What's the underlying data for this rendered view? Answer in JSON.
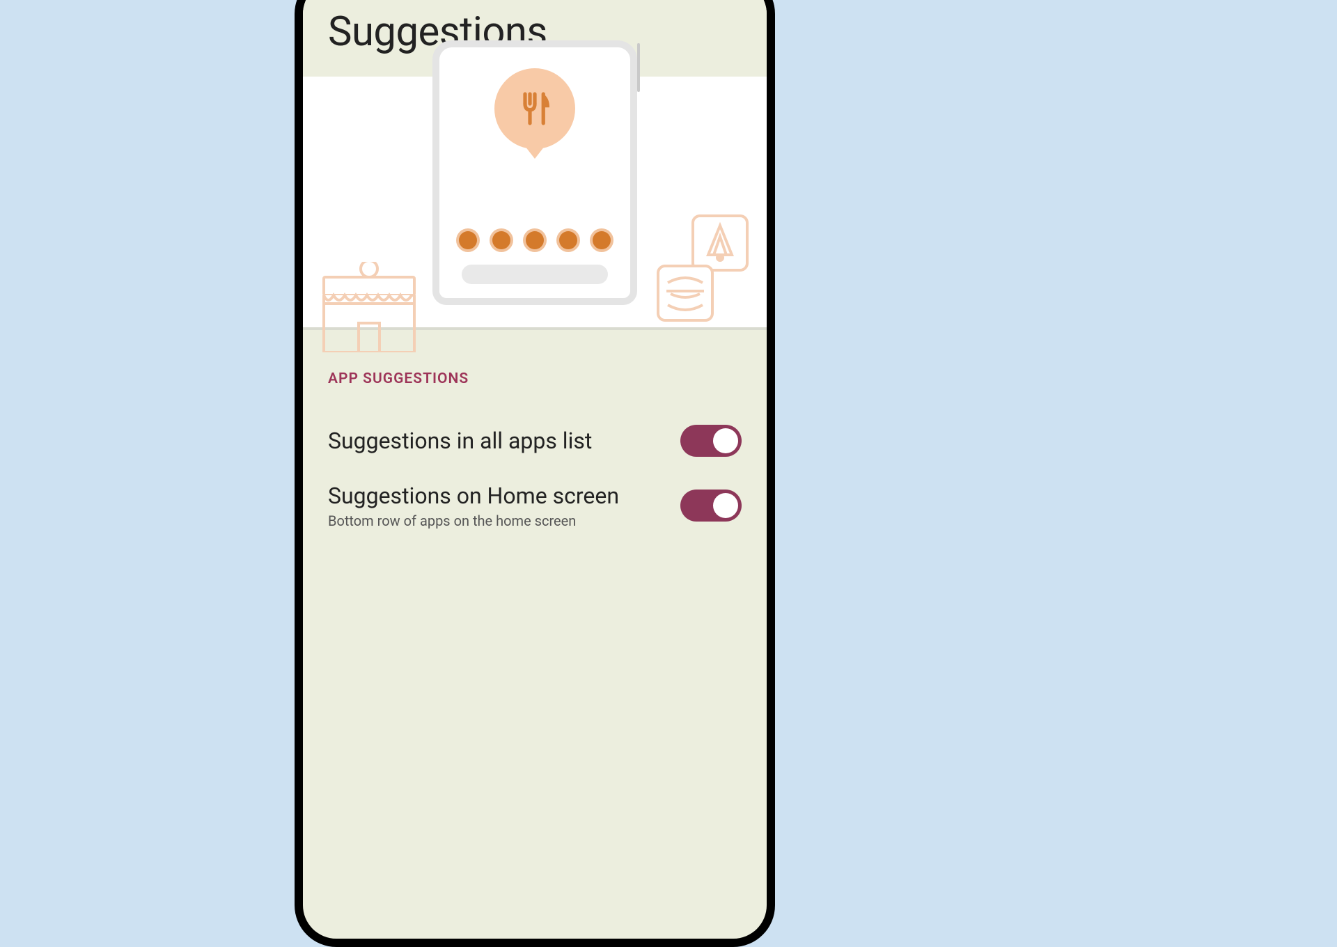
{
  "header": {
    "title": "Suggestions"
  },
  "section": {
    "label": "APP SUGGESTIONS"
  },
  "settings": [
    {
      "title": "Suggestions in all apps list",
      "subtitle": "",
      "enabled": true
    },
    {
      "title": "Suggestions on Home screen",
      "subtitle": "Bottom row of apps on the home screen",
      "enabled": true
    }
  ],
  "colors": {
    "accent": "#8d3759",
    "section_label": "#9d3458",
    "illustration_bubble": "#f8caa7",
    "illustration_icon": "#d88036"
  }
}
